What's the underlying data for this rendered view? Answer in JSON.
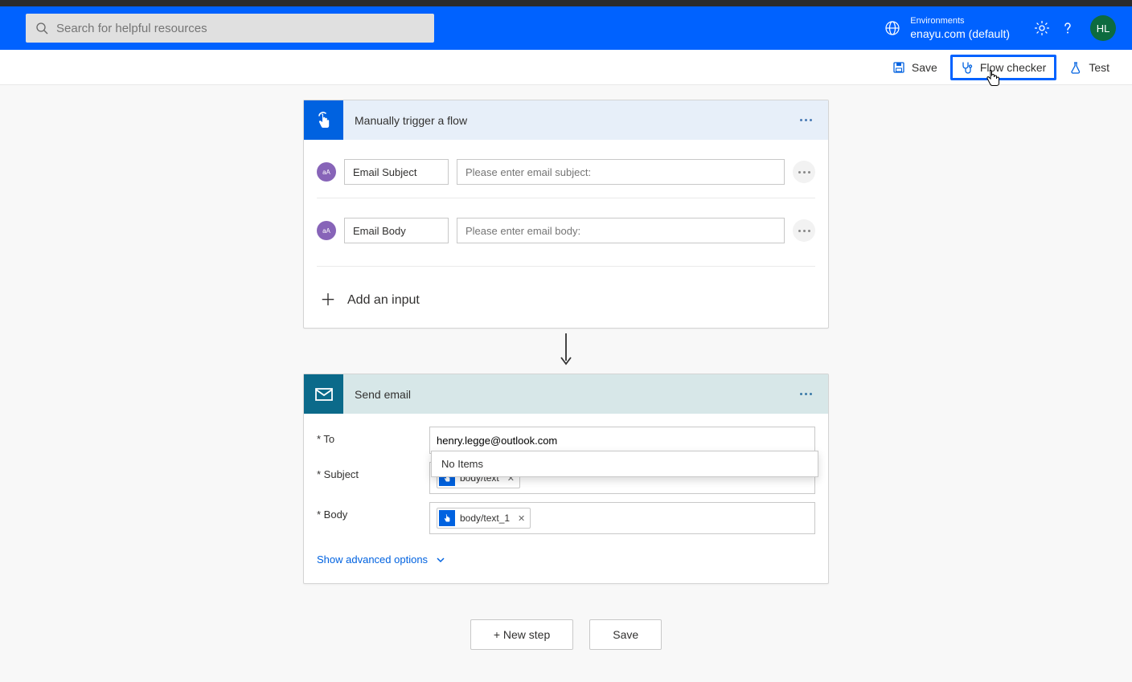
{
  "header": {
    "search_placeholder": "Search for helpful resources",
    "env_label": "Environments",
    "env_name": "enayu.com (default)",
    "avatar_initials": "HL"
  },
  "toolbar": {
    "save": "Save",
    "flow_checker": "Flow checker",
    "test": "Test"
  },
  "trigger": {
    "title": "Manually trigger a flow",
    "inputs": [
      {
        "badge": "aA",
        "name": "Email Subject",
        "placeholder": "Please enter email subject:"
      },
      {
        "badge": "aA",
        "name": "Email Body",
        "placeholder": "Please enter email body:"
      }
    ],
    "add_input_label": "Add an input"
  },
  "action": {
    "title": "Send email",
    "fields": {
      "to_label": "* To",
      "to_value": "henry.legge@outlook.com",
      "subject_label": "* Subject",
      "subject_token": "body/text",
      "body_label": "* Body",
      "body_token": "body/text_1"
    },
    "dropdown_text": "No Items",
    "advanced_label": "Show advanced options"
  },
  "bottom": {
    "new_step": "+ New step",
    "save": "Save"
  }
}
